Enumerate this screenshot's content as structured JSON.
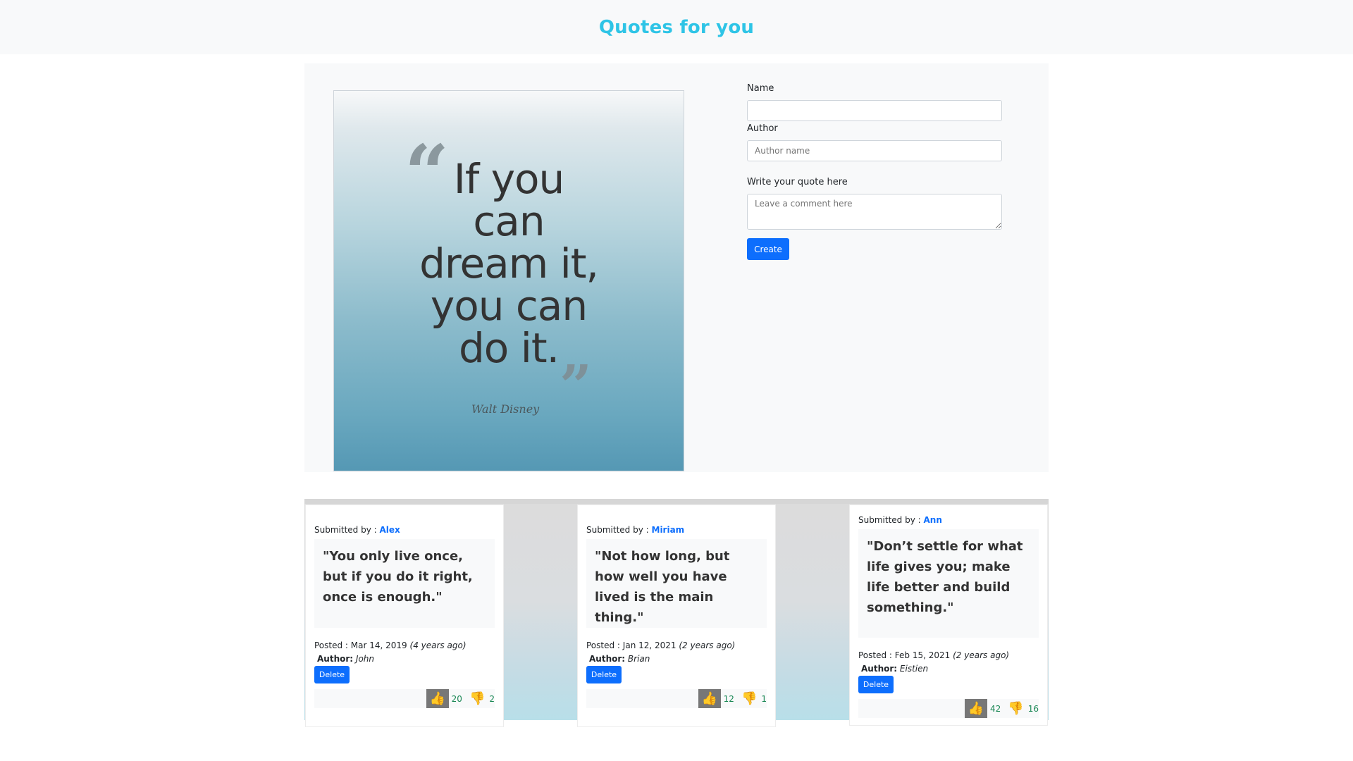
{
  "header": {
    "title": "Quotes for you"
  },
  "hero": {
    "lines": [
      "If you",
      "can",
      "dream it,",
      "you can",
      "do it."
    ],
    "open_quote": "“",
    "close_quote": "”",
    "signature": "Walt Disney"
  },
  "form": {
    "name_label": "Name",
    "name_value": "",
    "author_label": "Author",
    "author_placeholder": "Author name",
    "quote_label": "Write your quote here",
    "quote_placeholder": "Leave a comment here",
    "create_label": "Create"
  },
  "quotes": [
    {
      "submitted_label": "Submitted by :",
      "submitter": "Alex",
      "text": "\"You only live once, but if you do it right, once is enough.\"",
      "posted_label": "Posted :",
      "date": "Mar 14, 2019",
      "ago": "(4 years ago)",
      "author_label": "Author:",
      "author": "John",
      "delete_label": "Delete",
      "upvotes": "20",
      "downvotes": "2"
    },
    {
      "submitted_label": "Submitted by :",
      "submitter": "Miriam",
      "text": "\"Not how long, but how well you have lived is the main thing.\"",
      "posted_label": "Posted :",
      "date": "Jan 12, 2021",
      "ago": "(2 years ago)",
      "author_label": "Author:",
      "author": "Brian",
      "delete_label": "Delete",
      "upvotes": "12",
      "downvotes": "1"
    },
    {
      "submitted_label": "Submitted by :",
      "submitter": "Ann",
      "text": "\"Don’t settle for what life gives you; make life better and build something.\"",
      "posted_label": "Posted :",
      "date": "Feb 15, 2021",
      "ago": "(2 years ago)",
      "author_label": "Author:",
      "author": "Eistien",
      "delete_label": "Delete",
      "upvotes": "42",
      "downvotes": "16"
    }
  ],
  "icons": {
    "upvote": "thumbs-up-icon",
    "downvote": "thumbs-down-icon"
  },
  "colors": {
    "title": "#2ec4e6",
    "primary": "#0d6efd",
    "upvote": "#1f75e8",
    "downvote": "#dc3545",
    "count": "#198754"
  }
}
